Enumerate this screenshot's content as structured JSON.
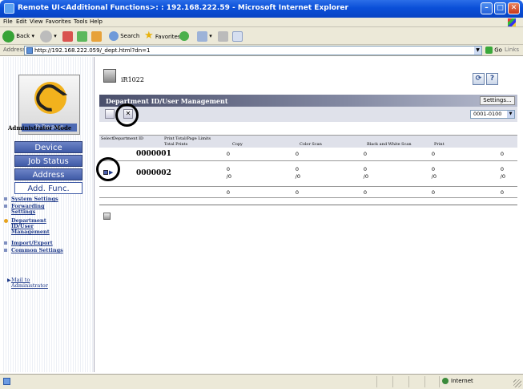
{
  "window": {
    "title": "Remote UI<Additional Functions>: : 192.168.222.59 - Microsoft Internet Explorer"
  },
  "menubar": [
    "File",
    "Edit",
    "View",
    "Favorites",
    "Tools",
    "Help"
  ],
  "toolbar": {
    "back": "Back",
    "search": "Search",
    "favorites": "Favorites"
  },
  "address": {
    "label": "Address",
    "url": "http://192.168.222.059/_dept.html?dn=1",
    "go": "Go",
    "links": "Links"
  },
  "sidebar": {
    "to_top": "To Top page",
    "mode": "Administrator Mode",
    "buttons": [
      {
        "label": "Device"
      },
      {
        "label": "Job Status"
      },
      {
        "label": "Address"
      },
      {
        "label": "Add. Func."
      }
    ],
    "links": [
      {
        "label": "System Settings"
      },
      {
        "label": "Forwarding Settings"
      },
      {
        "label": "Department ID/User Management"
      },
      {
        "label": "Import/Export"
      },
      {
        "label": "Common Settings"
      }
    ],
    "mail_to": "Mail to Administrator"
  },
  "main": {
    "device_name": "iR1022",
    "heading": "Department ID/User Management",
    "settings_button": "Settings...",
    "range": "0001-0100",
    "table": {
      "headers": {
        "select": "Select",
        "dept_id": "Department ID",
        "print_limits": "Print Total/Page Limits",
        "total_prints": "Total Prints",
        "copy": "Copy",
        "color_scan": "Color Scan",
        "bw_scan": "Black and White Scan",
        "print": "Print"
      },
      "rows": [
        {
          "dept": "0000001",
          "values": [
            "0",
            "0",
            "0",
            "0",
            "0"
          ],
          "limits": [
            "",
            "",
            "",
            "",
            ""
          ]
        },
        {
          "dept": "0000002",
          "values": [
            "0",
            "0",
            "0",
            "0",
            "0"
          ],
          "limits": [
            "/0",
            "/0",
            "/0",
            "/0",
            "/0"
          ]
        }
      ],
      "totals": [
        "0",
        "0",
        "0",
        "0",
        "0"
      ]
    }
  },
  "status": {
    "zone": "Internet"
  },
  "colors": {
    "title_bar": "#0a4fd8",
    "nav_button": "#3f5aa6",
    "header_band": "#4a4f6b"
  }
}
